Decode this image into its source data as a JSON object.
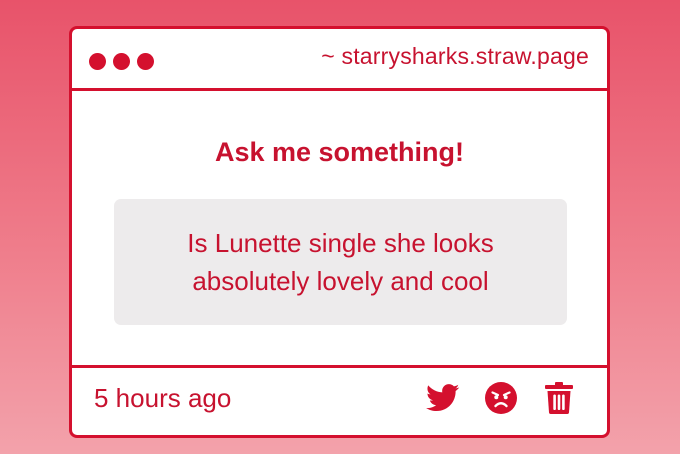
{
  "titlebar": {
    "url": "~ starrysharks.straw.page"
  },
  "content": {
    "heading": "Ask me something!",
    "question": "Is Lunette single she looks absolutely lovely and cool"
  },
  "footer": {
    "timestamp": "5 hours ago",
    "actions": [
      {
        "icon": "twitter-icon"
      },
      {
        "icon": "angry-face-icon"
      },
      {
        "icon": "trash-icon"
      }
    ]
  },
  "colors": {
    "accent": "#d4102e",
    "text": "#c7122f",
    "question_bg": "#edebec",
    "background_top": "#e8536a",
    "background_bottom": "#f3a2ab"
  }
}
